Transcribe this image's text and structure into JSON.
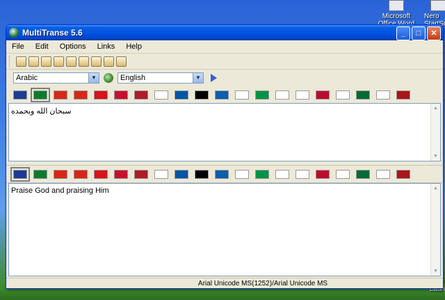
{
  "desktop": {
    "icons": [
      {
        "label": "Microsoft Office Word 2003"
      },
      {
        "label": "Nero StartSm"
      }
    ],
    "side_labels": [
      "S",
      "Laun"
    ]
  },
  "window": {
    "title": "MultiTranse 5.6",
    "controls": {
      "minimize": "_",
      "maximize": "□",
      "close": "✕"
    }
  },
  "menu": [
    "File",
    "Edit",
    "Options",
    "Links",
    "Help"
  ],
  "toolbar": {
    "icons": [
      "new-icon",
      "open-icon",
      "save-icon",
      "find-icon",
      "copy-icon",
      "print-icon",
      "paste-icon",
      "clear-icon",
      "speak-icon"
    ]
  },
  "languages": {
    "source": "Arabic",
    "target": "English"
  },
  "flags": {
    "codes": [
      "uk",
      "sa",
      "cn",
      "tw",
      "cz",
      "dk",
      "nl",
      "fi",
      "fr",
      "de",
      "gr",
      "il",
      "it",
      "jp",
      "kr",
      "no",
      "pl",
      "pt",
      "ru",
      "es"
    ],
    "colors": [
      "#1f3a93",
      "#0f7a2e",
      "#d62718",
      "#d62718",
      "#d7141a",
      "#c8102e",
      "#ae1c28",
      "#ffffff",
      "#0055a4",
      "#000000",
      "#0d5eaf",
      "#ffffff",
      "#009246",
      "#ffffff",
      "#ffffff",
      "#ba0c2f",
      "#ffffff",
      "#046a38",
      "#ffffff",
      "#aa151b"
    ],
    "source_selected": "sa",
    "target_selected": "uk"
  },
  "source_text": "سبحان الله وبحمده",
  "target_text": "Praise God and praising Him",
  "status": "Arial Unicode MS(1252)/Arial Unicode MS"
}
